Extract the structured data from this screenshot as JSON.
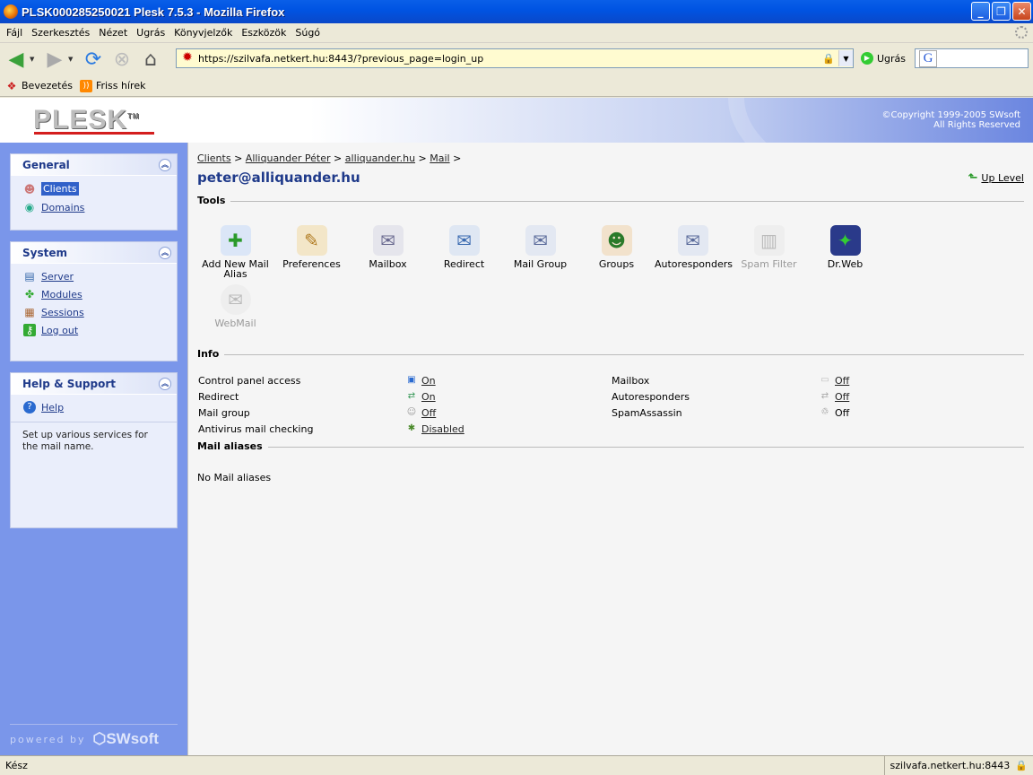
{
  "window": {
    "title": "PLSK000285250021 Plesk 7.5.3 - Mozilla Firefox"
  },
  "menu": [
    "Fájl",
    "Szerkesztés",
    "Nézet",
    "Ugrás",
    "Könyvjelzők",
    "Eszközök",
    "Súgó"
  ],
  "address": {
    "url": "https://szilvafa.netkert.hu:8443/?previous_page=login_up",
    "go_label": "Ugrás"
  },
  "bookmarks": [
    {
      "label": "Bevezetés",
      "icon": "firefox-icon"
    },
    {
      "label": "Friss hírek",
      "icon": "rss-icon"
    }
  ],
  "header": {
    "logo": "PLESK",
    "tm": "TM",
    "copyright_line1": "©Copyright 1999-2005 SWsoft",
    "copyright_line2": "All Rights Reserved"
  },
  "sidebar": {
    "general": {
      "title": "General",
      "items": [
        {
          "label": "Clients",
          "icon": "clients-icon",
          "selected": true
        },
        {
          "label": "Domains",
          "icon": "domains-icon"
        }
      ]
    },
    "system": {
      "title": "System",
      "items": [
        {
          "label": "Server",
          "icon": "server-icon"
        },
        {
          "label": "Modules",
          "icon": "modules-icon"
        },
        {
          "label": "Sessions",
          "icon": "sessions-icon"
        },
        {
          "label": "Log out",
          "icon": "logout-icon"
        }
      ]
    },
    "help": {
      "title": "Help & Support",
      "items": [
        {
          "label": "Help",
          "icon": "help-icon"
        }
      ],
      "text": "Set up various services for the mail name."
    },
    "powered_by": "powered by",
    "brand": "SWsoft"
  },
  "content": {
    "breadcrumb": [
      "Clients",
      "Alliquander Péter",
      "alliquander.hu",
      "Mail"
    ],
    "title": "peter@alliquander.hu",
    "up_level": "Up Level",
    "tools_title": "Tools",
    "tools": [
      {
        "label": "Add New Mail Alias",
        "icon": "add-alias-icon",
        "enabled": true
      },
      {
        "label": "Preferences",
        "icon": "preferences-icon",
        "enabled": true
      },
      {
        "label": "Mailbox",
        "icon": "mailbox-icon",
        "enabled": true
      },
      {
        "label": "Redirect",
        "icon": "redirect-icon",
        "enabled": true
      },
      {
        "label": "Mail Group",
        "icon": "mail-group-icon",
        "enabled": true
      },
      {
        "label": "Groups",
        "icon": "groups-icon",
        "enabled": true
      },
      {
        "label": "Autoresponders",
        "icon": "autoresponders-icon",
        "enabled": true
      },
      {
        "label": "Spam Filter",
        "icon": "spam-filter-icon",
        "enabled": false
      },
      {
        "label": "Dr.Web",
        "icon": "drweb-icon",
        "enabled": true
      },
      {
        "label": "WebMail",
        "icon": "webmail-icon",
        "enabled": false
      }
    ],
    "info_title": "Info",
    "info_left": [
      {
        "label": "Control panel access",
        "value": "On"
      },
      {
        "label": "Redirect",
        "value": "On"
      },
      {
        "label": "Mail group",
        "value": "Off"
      },
      {
        "label": "Antivirus mail checking",
        "value": "Disabled"
      }
    ],
    "info_right": [
      {
        "label": "Mailbox",
        "value": "Off"
      },
      {
        "label": "Autoresponders",
        "value": "Off"
      },
      {
        "label": "SpamAssassin",
        "value": "Off"
      }
    ],
    "aliases_title": "Mail aliases",
    "aliases_empty": "No Mail aliases"
  },
  "status": {
    "text": "Kész",
    "host": "szilvafa.netkert.hu:8443"
  }
}
